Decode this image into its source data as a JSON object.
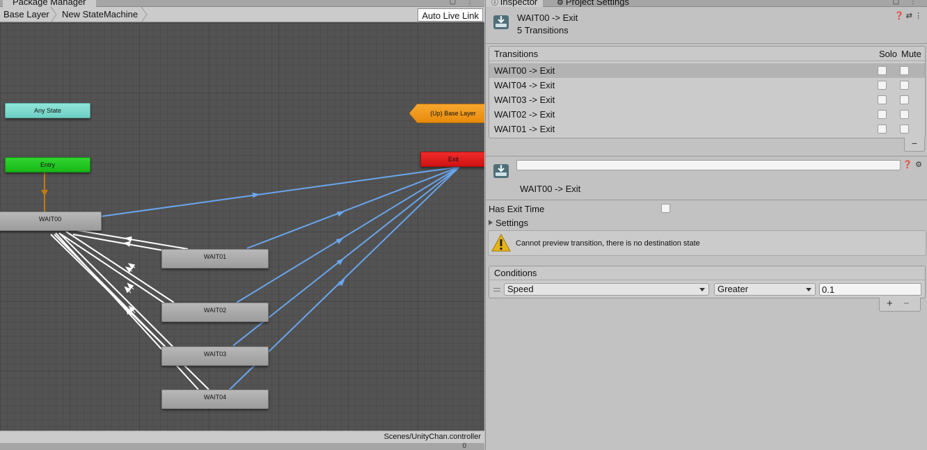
{
  "animator": {
    "top_tab": "Package Manager",
    "breadcrumbs": [
      "Base Layer",
      "New StateMachine"
    ],
    "live_link": "Auto Live Link",
    "nodes": {
      "any_state": "Any State",
      "entry": "Entry",
      "exit": "Exit",
      "up": "(Up) Base Layer",
      "wait00": "WAIT00",
      "wait01": "WAIT01",
      "wait02": "WAIT02",
      "wait03": "WAIT03",
      "wait04": "WAIT04"
    },
    "status_path": "Scenes/UnityChan.controller",
    "bottom_hint": "0"
  },
  "inspector": {
    "tabs": [
      "Inspector",
      "Project Settings"
    ],
    "title": "WAIT00 -> Exit",
    "subtitle": "5 Transitions",
    "transitions": {
      "header": "Transitions",
      "solo": "Solo",
      "mute": "Mute",
      "rows": [
        {
          "label": "WAIT00 -> Exit",
          "selected": true
        },
        {
          "label": "WAIT04 -> Exit",
          "selected": false
        },
        {
          "label": "WAIT03 -> Exit",
          "selected": false
        },
        {
          "label": "WAIT02 -> Exit",
          "selected": false
        },
        {
          "label": "WAIT01 -> Exit",
          "selected": false
        }
      ]
    },
    "transition_name": "WAIT00 -> Exit",
    "name_value": "",
    "has_exit_time": "Has Exit Time",
    "settings": "Settings",
    "warning": "Cannot preview transition, there is no destination state",
    "conditions": {
      "header": "Conditions",
      "parameter": "Speed",
      "mode": "Greater",
      "threshold": "0.1"
    }
  },
  "colors": {
    "transition_blue": "#6aa6ee",
    "transition_white": "#ffffff",
    "entry_orange": "#c47a12"
  }
}
